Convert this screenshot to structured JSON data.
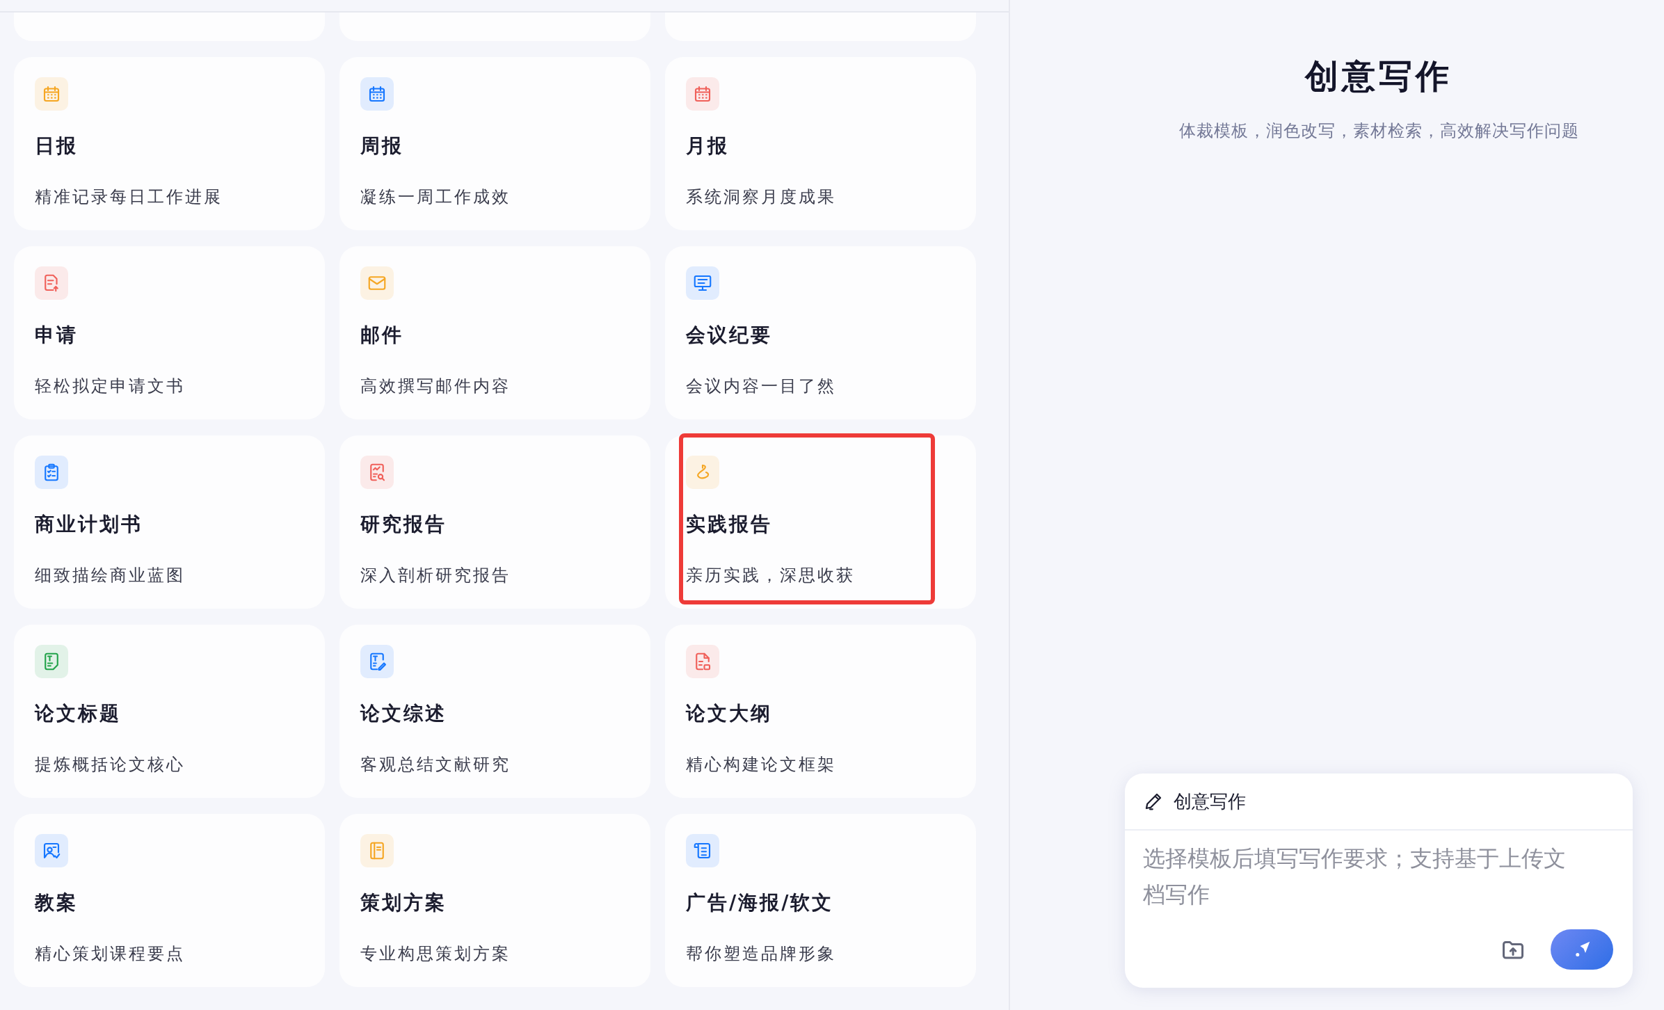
{
  "cards": [
    {
      "kind": "calendar",
      "color": "#f5a623",
      "title": "日报",
      "desc": "精准记录每日工作进展",
      "highlighted": false
    },
    {
      "kind": "calendar",
      "color": "#1677ff",
      "title": "周报",
      "desc": "凝练一周工作成效",
      "highlighted": false
    },
    {
      "kind": "calendar",
      "color": "#f0605a",
      "title": "月报",
      "desc": "系统洞察月度成果",
      "highlighted": false
    },
    {
      "kind": "doc-upload",
      "color": "#f0605a",
      "title": "申请",
      "desc": "轻松拟定申请文书",
      "highlighted": false
    },
    {
      "kind": "mail",
      "color": "#f5a623",
      "title": "邮件",
      "desc": "高效撰写邮件内容",
      "highlighted": false
    },
    {
      "kind": "presentation",
      "color": "#1677ff",
      "title": "会议纪要",
      "desc": "会议内容一目了然",
      "highlighted": false
    },
    {
      "kind": "clipboard",
      "color": "#1677ff",
      "title": "商业计划书",
      "desc": "细致描绘商业蓝图",
      "highlighted": false
    },
    {
      "kind": "doc-search",
      "color": "#f0605a",
      "title": "研究报告",
      "desc": "深入剖析研究报告",
      "highlighted": false
    },
    {
      "kind": "flag",
      "color": "#f5a623",
      "title": "实践报告",
      "desc": "亲历实践，深思收获",
      "highlighted": true
    },
    {
      "kind": "doc-text",
      "color": "#22a34a",
      "title": "论文标题",
      "desc": "提炼概括论文核心",
      "highlighted": false
    },
    {
      "kind": "doc-edit",
      "color": "#1677ff",
      "title": "论文综述",
      "desc": "客观总结文献研究",
      "highlighted": false
    },
    {
      "kind": "doc-lock",
      "color": "#f0605a",
      "title": "论文大纲",
      "desc": "精心构建论文框架",
      "highlighted": false
    },
    {
      "kind": "person-card",
      "color": "#1677ff",
      "title": "教案",
      "desc": "精心策划课程要点",
      "highlighted": false
    },
    {
      "kind": "book",
      "color": "#f5a623",
      "title": "策划方案",
      "desc": "专业构思策划方案",
      "highlighted": false
    },
    {
      "kind": "scroll",
      "color": "#1677ff",
      "title": "广告/海报/软文",
      "desc": "帮你塑造品牌形象",
      "highlighted": false
    }
  ],
  "panel": {
    "title": "创意写作",
    "subtitle": "体裁模板，润色改写，素材检索，高效解决写作问题"
  },
  "composer": {
    "mode": "创意写作",
    "placeholder": "选择模板后填写写作要求；支持基于上传文档写作"
  }
}
